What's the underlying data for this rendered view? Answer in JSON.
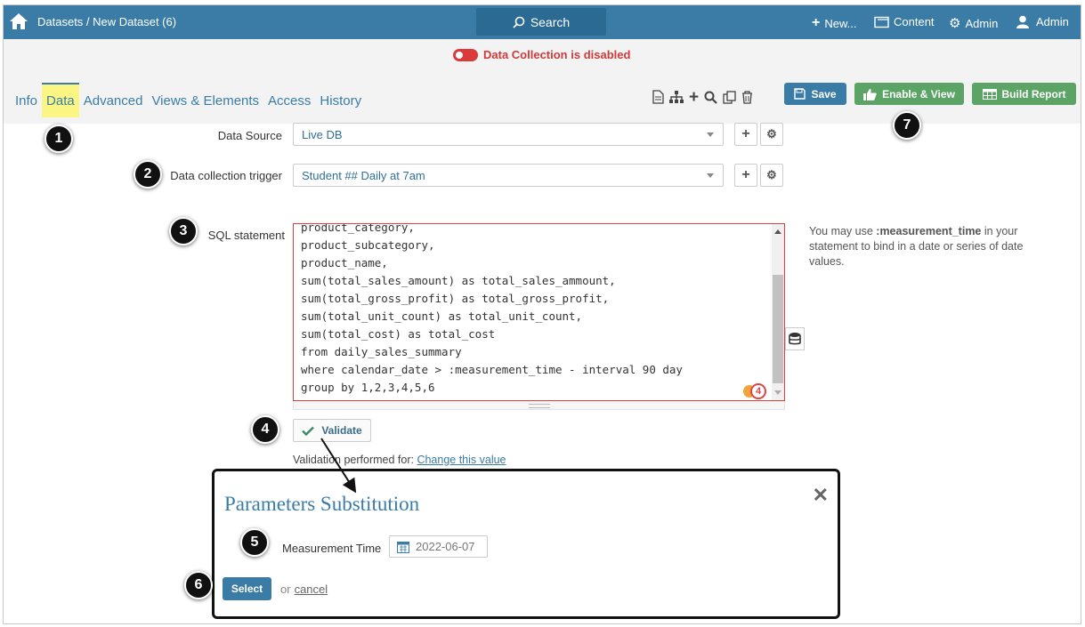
{
  "topbar": {
    "breadcrumb": "Datasets / New Dataset (6)",
    "search_label": "Search",
    "new_label": "New...",
    "content_label": "Content",
    "admin_menu_label": "Admin",
    "user_label": "Admin"
  },
  "status": {
    "data_collection": "Data Collection is disabled"
  },
  "tabs": [
    {
      "label": "Info"
    },
    {
      "label": "Data"
    },
    {
      "label": "Advanced"
    },
    {
      "label": "Views & Elements"
    },
    {
      "label": "Access"
    },
    {
      "label": "History"
    }
  ],
  "toolbar": {
    "save_label": "Save",
    "enable_label": "Enable & View",
    "build_label": "Build Report"
  },
  "form": {
    "data_source_label": "Data Source",
    "data_source_value": "Live DB",
    "trigger_label": "Data collection trigger",
    "trigger_value": "Student ## Daily at 7am",
    "sql_label": "SQL statement",
    "sql_lines": [
      "product_category,",
      "product_subcategory,",
      "product_name,",
      "sum(total_sales_amount) as total_sales_ammount,",
      "sum(total_gross_profit) as total_gross_profit,",
      "sum(total_unit_count) as total_unit_count,",
      "sum(total_cost) as total_cost",
      "from daily_sales_summary",
      "where calendar_date > :measurement_time - interval 90 day",
      "group by 1,2,3,4,5,6"
    ],
    "sql_badge": "4",
    "hint_pre": "You may use ",
    "hint_bold": ":measurement_time",
    "hint_post": " in your statement to bind in a date or series of date values.",
    "validate_label": "Validate",
    "validation_text": "Validation performed for: ",
    "change_link": "Change this value"
  },
  "modal": {
    "title": "Parameters Substitution",
    "close": "✕",
    "measurement_label": "Measurement Time",
    "measurement_value": "2022-06-07",
    "select_label": "Select",
    "or_text": "or",
    "cancel_label": "cancel"
  },
  "callouts": [
    "1",
    "2",
    "3",
    "4",
    "5",
    "6",
    "7"
  ],
  "colors": {
    "brand": "#3a7ca6",
    "success": "#5ba466",
    "danger": "#d93a3a",
    "highlight": "#fbf584"
  }
}
